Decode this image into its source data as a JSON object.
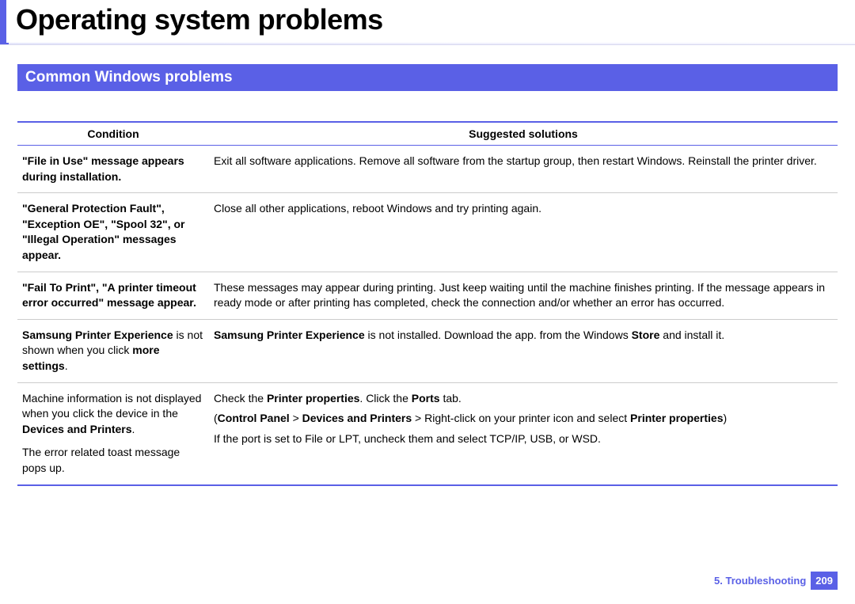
{
  "page_title": "Operating system problems",
  "section_title": "Common Windows problems",
  "table": {
    "headers": {
      "condition": "Condition",
      "solutions": "Suggested solutions"
    }
  },
  "rows": {
    "r1": {
      "cond_b1": "\"File in Use\" message appears during installation.",
      "sol": "Exit all software applications. Remove all software from the startup group, then restart Windows. Reinstall the printer driver."
    },
    "r2": {
      "cond_b1": "\"General Protection Fault\", \"Exception OE\", \"Spool 32\", or \"Illegal Operation\" messages appear.",
      "sol": "Close all other applications, reboot Windows and try printing again."
    },
    "r3": {
      "cond_b1": "\"Fail To Print\", \"A printer timeout error occurred\" message appear.",
      "sol": "These messages may appear during printing. Just keep waiting until the machine finishes printing. If the message appears in ready mode or after printing has completed, check the connection and/or whether an error has occurred."
    },
    "r4": {
      "c1": "Samsung Printer Experience",
      "c2": " is not shown when you click ",
      "c3": "more settings",
      "c4": ".",
      "s1": "Samsung Printer Experience",
      "s2": " is not installed. Download the app. from the  Windows ",
      "s3": "Store",
      "s4": " and install it."
    },
    "r5": {
      "c1": "Machine information is not displayed when you click the device in the ",
      "c2": "Devices and Printers",
      "c3": ".",
      "c4": "The error related toast message pops up.",
      "s1a": "Check the ",
      "s1b": "Printer properties",
      "s1c": ". Click the ",
      "s1d": "Ports",
      "s1e": " tab.",
      "s2a": "(",
      "s2b": "Control Panel",
      "s2c": " > ",
      "s2d": "Devices and Printers",
      "s2e": " > Right-click on your printer icon and select ",
      "s2f": "Printer properties",
      "s2g": ")",
      "s3": "If the port is set to File or LPT, uncheck them and select TCP/IP, USB, or WSD."
    }
  },
  "footer": {
    "chapter": "5.  Troubleshooting",
    "page": "209"
  }
}
